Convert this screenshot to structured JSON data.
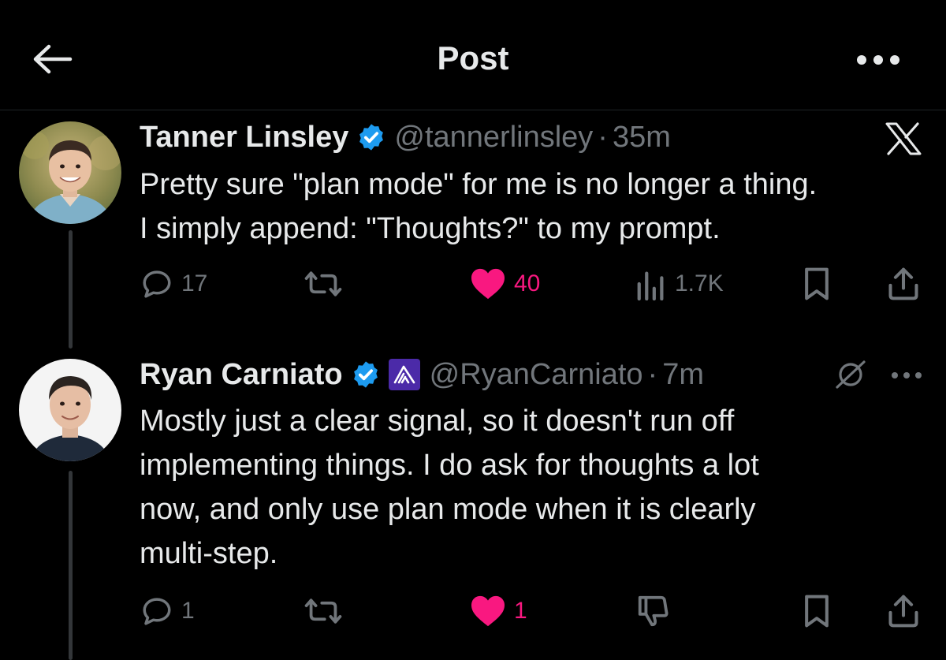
{
  "header": {
    "title": "Post",
    "back_icon": "arrow-left-icon",
    "more_icon": "more-horizontal-icon"
  },
  "posts": [
    {
      "author": {
        "name": "Tanner Linsley",
        "handle": "@tannerlinsley",
        "time": "35m",
        "verified": true
      },
      "source_badge_icon": "x-logo-icon",
      "body_lines": [
        "Pretty sure \"plan mode\" for me is no longer a thing.",
        "I simply append: \"Thoughts?\" to my prompt."
      ],
      "actions": {
        "replies": "17",
        "reposts": "",
        "likes": "40",
        "liked": true,
        "views": "1.7K"
      }
    },
    {
      "author": {
        "name": "Ryan Carniato",
        "handle": "@RyanCarniato",
        "time": "7m",
        "verified": true,
        "affiliate_badge_icon": "solid-js-logo-icon"
      },
      "corner_icons": [
        "grok-icon",
        "more-horizontal-icon"
      ],
      "body_lines": [
        "Mostly just a clear signal, so it doesn't run off",
        "implementing things. I do ask for thoughts a lot",
        "now, and only use plan mode when it is clearly",
        "multi-step."
      ],
      "actions": {
        "replies": "1",
        "reposts": "",
        "likes": "1",
        "liked": true
      }
    }
  ],
  "colors": {
    "background": "#000000",
    "text_primary": "#e7e9ea",
    "text_secondary": "#71767b",
    "like": "#f91880",
    "verified": "#1d9bf0",
    "thread_line": "#333639"
  }
}
